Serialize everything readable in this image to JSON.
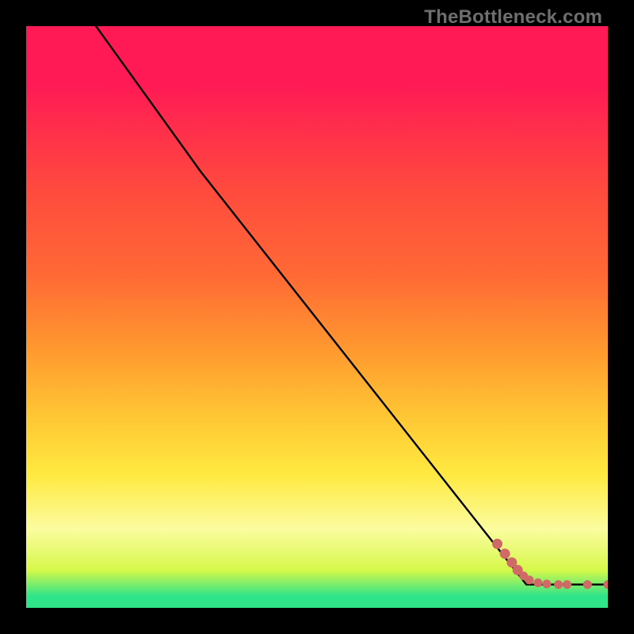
{
  "watermark": "TheBottleneck.com",
  "colors": {
    "line": "#000000",
    "dot_fill": "#cf6a67",
    "dot_stroke": "#cf6a67",
    "band_green": "#2fe489",
    "band_lime": "#d6f84a",
    "band_paleyellow": "#fbfc9f",
    "band_yellow": "#ffe940",
    "band_gold": "#ffc634",
    "band_orange": "#ff9a2f",
    "band_orangered": "#ff6a35",
    "band_redorange": "#ff4a3e",
    "band_red_top": "#ff1a55"
  },
  "chart_data": {
    "type": "line",
    "title": "",
    "xlabel": "",
    "ylabel": "",
    "xlim": [
      0,
      100
    ],
    "ylim": [
      0,
      100
    ],
    "note": "Axes are unlabeled in the source; values are normalized 0–100 from pixel positions.",
    "series": [
      {
        "name": "curve",
        "x": [
          12.0,
          30.0,
          86.0,
          100.0
        ],
        "y": [
          100.0,
          75.0,
          4.0,
          4.0
        ]
      }
    ],
    "dots": {
      "name": "highlight-points",
      "x": [
        81.0,
        82.3,
        83.5,
        84.5,
        85.5,
        86.5,
        88.0,
        89.5,
        91.5,
        93.0,
        96.5,
        100.0
      ],
      "y": [
        11.0,
        9.3,
        7.8,
        6.5,
        5.5,
        4.8,
        4.3,
        4.1,
        4.0,
        4.0,
        4.0,
        4.0
      ]
    },
    "gradient_bands_pct_from_top": [
      {
        "from": 0,
        "to": 20,
        "color_key": "band_red_top"
      },
      {
        "from": 20,
        "to": 36,
        "color_key": "band_redorange"
      },
      {
        "from": 36,
        "to": 50,
        "color_key": "band_orangered"
      },
      {
        "from": 50,
        "to": 62,
        "color_key": "band_orange"
      },
      {
        "from": 62,
        "to": 72,
        "color_key": "band_gold"
      },
      {
        "from": 72,
        "to": 82,
        "color_key": "band_yellow"
      },
      {
        "from": 82,
        "to": 91,
        "color_key": "band_paleyellow"
      },
      {
        "from": 91,
        "to": 96,
        "color_key": "band_lime"
      },
      {
        "from": 96,
        "to": 100,
        "color_key": "band_green"
      }
    ]
  }
}
